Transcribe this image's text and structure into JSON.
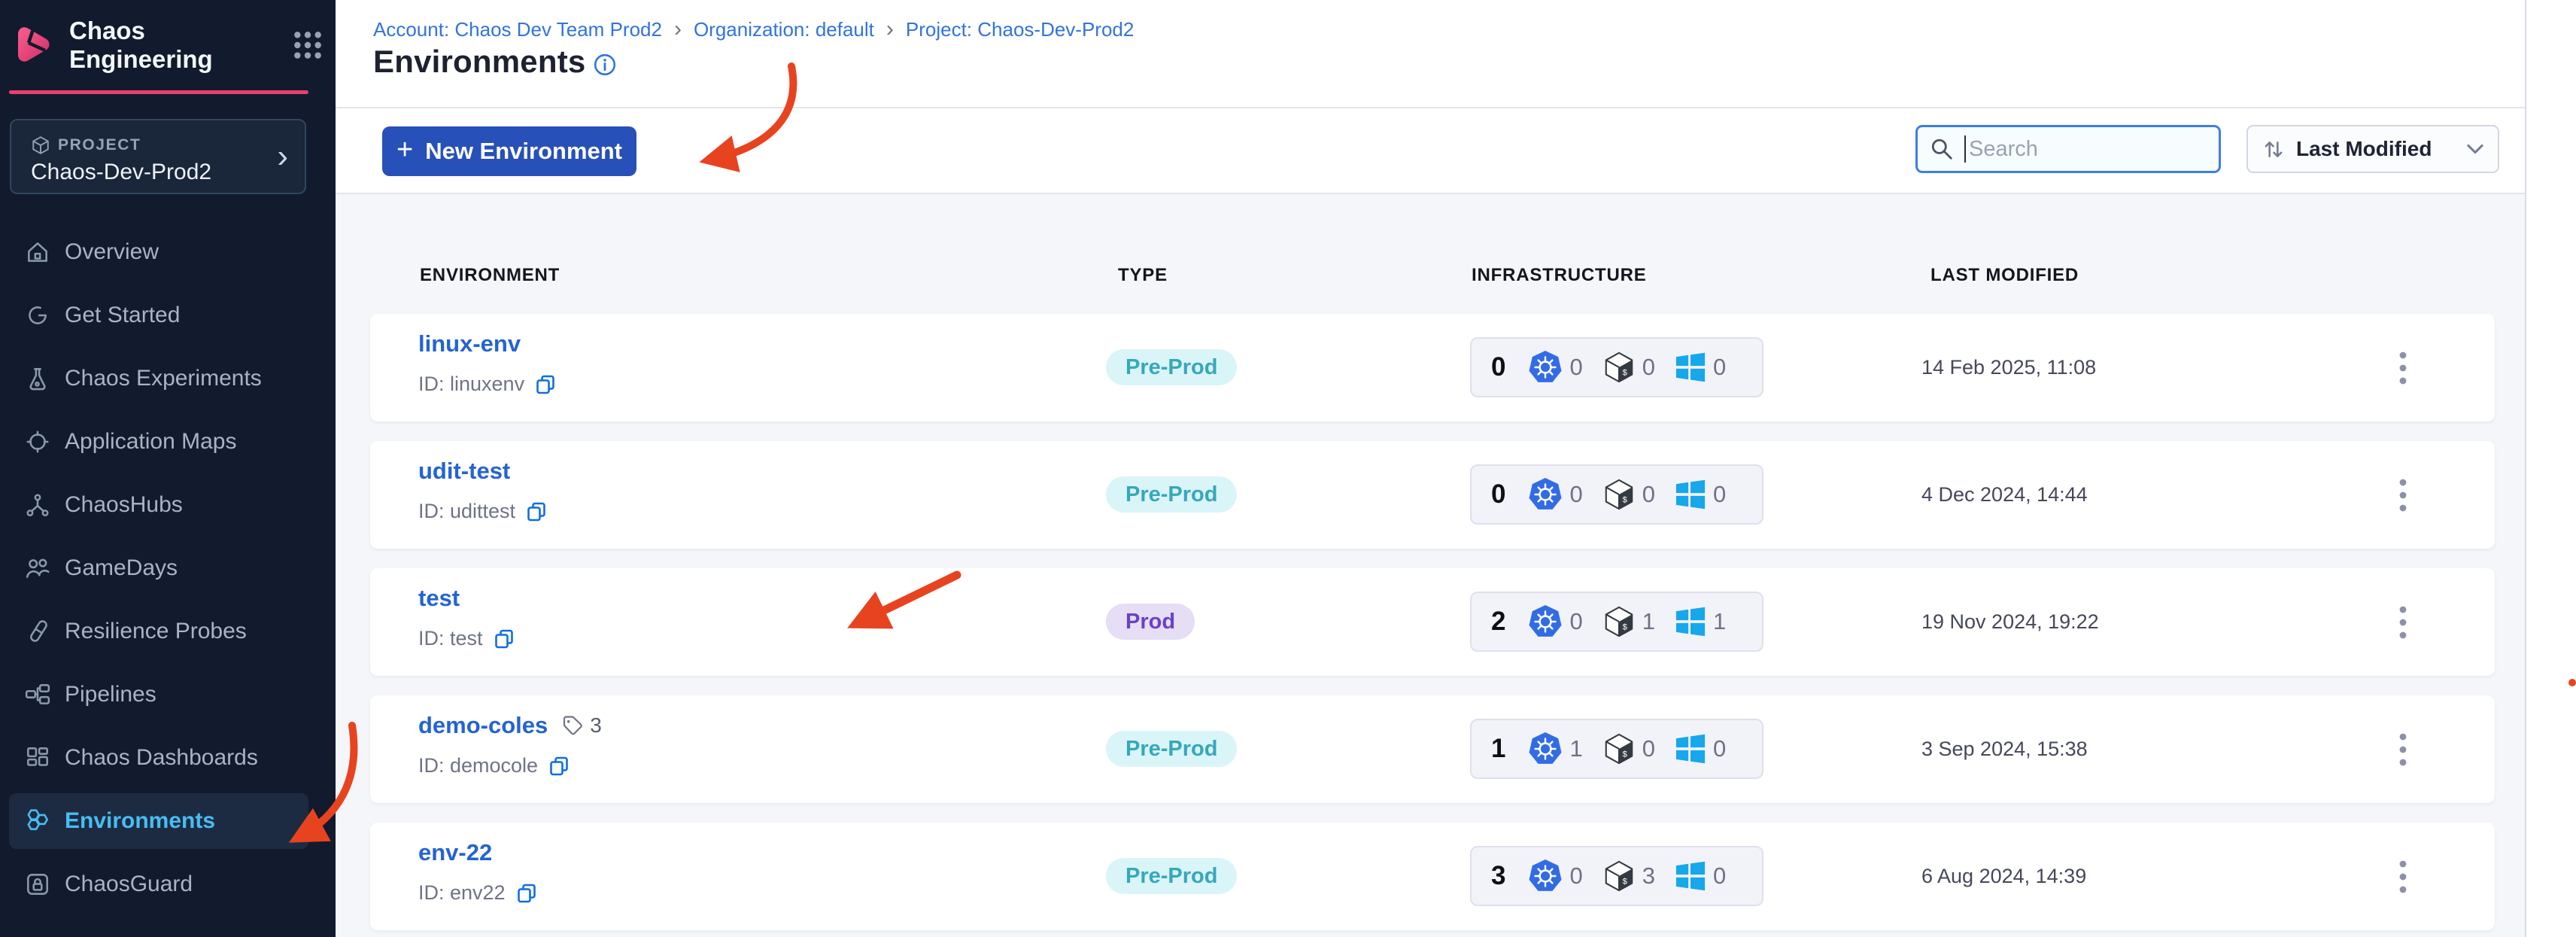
{
  "app": {
    "module_title": "Chaos Engineering"
  },
  "sidebar": {
    "project_label": "PROJECT",
    "project_name": "Chaos-Dev-Prod2",
    "items": [
      {
        "label": "Overview"
      },
      {
        "label": "Get Started"
      },
      {
        "label": "Chaos Experiments"
      },
      {
        "label": "Application Maps"
      },
      {
        "label": "ChaosHubs"
      },
      {
        "label": "GameDays"
      },
      {
        "label": "Resilience Probes"
      },
      {
        "label": "Pipelines"
      },
      {
        "label": "Chaos Dashboards"
      },
      {
        "label": "Environments",
        "active": true
      },
      {
        "label": "ChaosGuard"
      }
    ]
  },
  "breadcrumb": {
    "items": [
      {
        "label": "Account: Chaos Dev Team Prod2"
      },
      {
        "label": "Organization: default"
      },
      {
        "label": "Project: Chaos-Dev-Prod2"
      }
    ]
  },
  "icons": {
    "breadcrumb_separator": "›",
    "chevron_right": "›",
    "plus": "+"
  },
  "page": {
    "title": "Environments"
  },
  "toolbar": {
    "new_environment_label": "New Environment",
    "search_placeholder": "Search",
    "sort_label": "Last Modified"
  },
  "table": {
    "headers": [
      "ENVIRONMENT",
      "TYPE",
      "INFRASTRUCTURE",
      "LAST MODIFIED"
    ],
    "rows": [
      {
        "name": "linux-env",
        "id_label": "ID: linuxenv",
        "type": "Pre-Prod",
        "infra_total": "0",
        "infra_k8s": "0",
        "infra_linux": "0",
        "infra_windows": "0",
        "last_modified": "14 Feb 2025, 11:08"
      },
      {
        "name": "udit-test",
        "id_label": "ID: udittest",
        "type": "Pre-Prod",
        "infra_total": "0",
        "infra_k8s": "0",
        "infra_linux": "0",
        "infra_windows": "0",
        "last_modified": "4 Dec 2024, 14:44"
      },
      {
        "name": "test",
        "id_label": "ID: test",
        "type": "Prod",
        "infra_total": "2",
        "infra_k8s": "0",
        "infra_linux": "1",
        "infra_windows": "1",
        "last_modified": "19 Nov 2024, 19:22"
      },
      {
        "name": "demo-coles",
        "tags_count": "3",
        "id_label": "ID: democole",
        "type": "Pre-Prod",
        "infra_total": "1",
        "infra_k8s": "1",
        "infra_linux": "0",
        "infra_windows": "0",
        "last_modified": "3 Sep 2024, 15:38"
      },
      {
        "name": "env-22",
        "id_label": "ID: env22",
        "type": "Pre-Prod",
        "infra_total": "3",
        "infra_k8s": "0",
        "infra_linux": "3",
        "infra_windows": "0",
        "last_modified": "6 Aug 2024, 14:39"
      }
    ]
  },
  "colors": {
    "sidebar_bg": "#111b2d",
    "brand_pink": "#ef3d6d",
    "primary_button_blue": "#2750b9",
    "link_blue": "#3273de",
    "env_name_blue": "#2463d4",
    "active_nav_blue": "#47bdf3",
    "preprod_badge_bg": "#d9f5f8",
    "preprod_badge_text": "#38a7ba",
    "prod_badge_bg": "#e5def5",
    "prod_badge_text": "#6b41c6",
    "annotation_red": "#e8431f"
  }
}
